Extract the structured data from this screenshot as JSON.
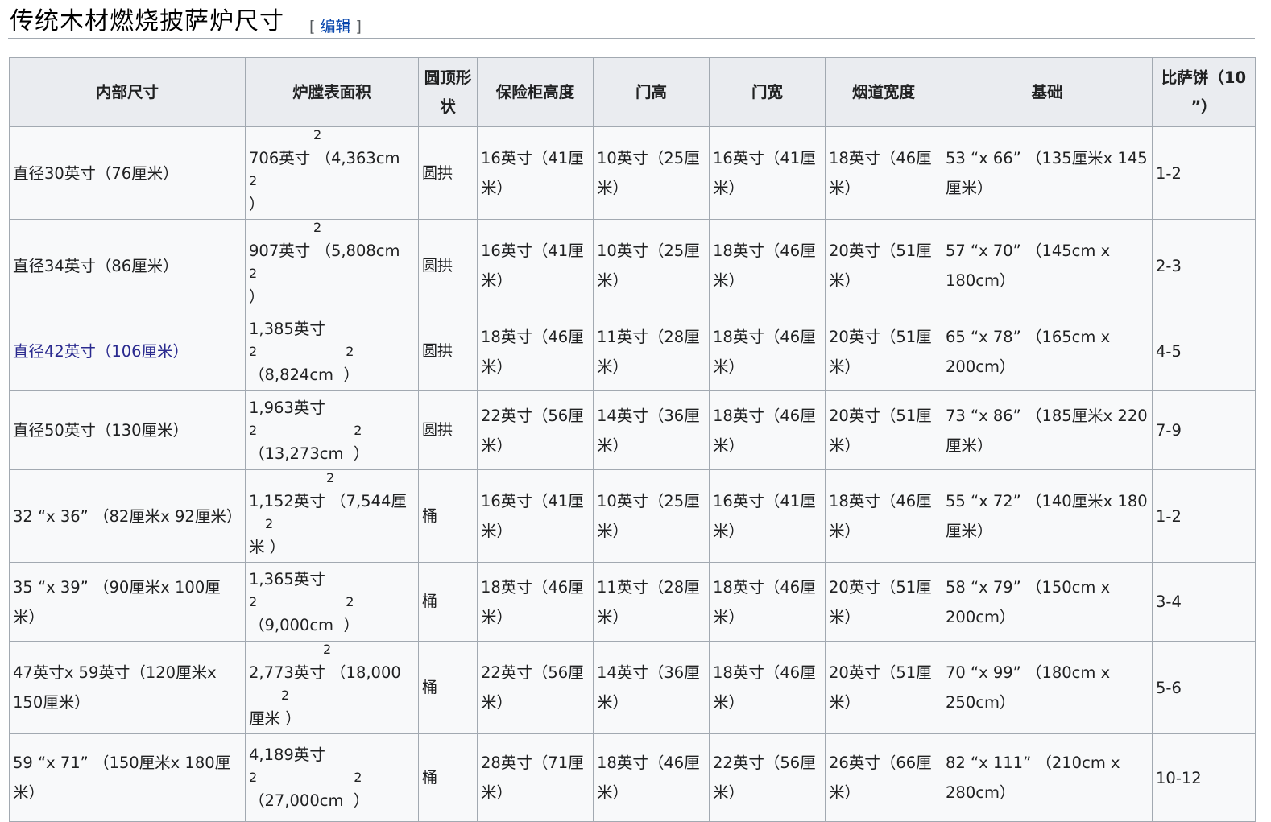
{
  "heading": {
    "title": "传统木材燃烧披萨炉尺寸",
    "edit_open": "[",
    "edit_label": "编辑",
    "edit_close": "]"
  },
  "table": {
    "headers": [
      "内部尺寸",
      "炉膛表面积",
      "圆顶形状",
      "保险柜高度",
      "门高",
      "门宽",
      "烟道宽度",
      "基础",
      "比萨饼（10 ”）"
    ],
    "rows": [
      {
        "inside": "直径30英寸（76厘米）",
        "area_main": "706英寸",
        "area_sup": "2",
        "area_metric": "（4,363cm",
        "area_sub": "2",
        "area_close": "）",
        "shape": "圆拱",
        "vault": "16英寸（41厘米）",
        "door_h": "10英寸（25厘米）",
        "door_w": "16英寸（41厘米）",
        "flue": "18英寸（46厘米）",
        "base": "53 “x 66” （135厘米x 145厘米）",
        "pizzas": "1-2"
      },
      {
        "inside": "直径34英寸（86厘米）",
        "area_main": "907英寸",
        "area_sup": "2",
        "area_metric": "（5,808cm",
        "area_sub": "2",
        "area_close": "）",
        "shape": "圆拱",
        "vault": "16英寸（41厘米）",
        "door_h": "10英寸（25厘米）",
        "door_w": "18英寸（46厘米）",
        "flue": "20英寸（51厘米）",
        "base": "57 “x 70” （145cm x 180cm）",
        "pizzas": "2-3"
      },
      {
        "inside": "直径42英寸（106厘米）",
        "area_main": "1,385英寸",
        "area_sup": "2",
        "area_metric": "（8,824cm",
        "area_sub": "2",
        "area_close": "）",
        "shape": "圆拱",
        "vault": "18英寸（46厘米）",
        "door_h": "11英寸（28厘米）",
        "door_w": "18英寸（46厘米）",
        "flue": "20英寸（51厘米）",
        "base": "65 “x 78” （165cm x 200cm）",
        "pizzas": "4-5"
      },
      {
        "inside": "直径50英寸（130厘米）",
        "area_main": "1,963英寸",
        "area_sup": "2",
        "area_metric": "（13,273cm",
        "area_sub": "2",
        "area_close": "）",
        "shape": "圆拱",
        "vault": "22英寸（56厘米）",
        "door_h": "14英寸（36厘米）",
        "door_w": "18英寸（46厘米）",
        "flue": "20英寸（51厘米）",
        "base": "73 “x 86” （185厘米x 220厘米）",
        "pizzas": "7-9"
      },
      {
        "inside": "32 “x 36” （82厘米x 92厘米）",
        "area_main": "1,152英寸",
        "area_sup": "2",
        "area_metric": "（7,544厘",
        "area_sub": "2",
        "area_close": "米 ）",
        "shape": "桶",
        "vault": "16英寸（41厘米）",
        "door_h": "10英寸（25厘米）",
        "door_w": "16英寸（41厘米）",
        "flue": "18英寸（46厘米）",
        "base": "55 “x 72” （140厘米x 180厘米）",
        "pizzas": "1-2"
      },
      {
        "inside": "35 “x 39” （90厘米x 100厘米）",
        "area_main": "1,365英寸",
        "area_sup": "2",
        "area_metric": "（9,000cm",
        "area_sub": "2",
        "area_close": "）",
        "shape": "桶",
        "vault": "18英寸（46厘米）",
        "door_h": "11英寸（28厘米）",
        "door_w": "18英寸（46厘米）",
        "flue": "20英寸（51厘米）",
        "base": "58 “x 79” （150cm x 200cm）",
        "pizzas": "3-4"
      },
      {
        "inside": "47英寸x 59英寸（120厘米x 150厘米）",
        "area_main": "2,773英寸",
        "area_sup": "2",
        "area_metric": "（18,000",
        "area_sub": "2",
        "area_close": "厘米 ）",
        "shape": "桶",
        "vault": "22英寸（56厘米）",
        "door_h": "14英寸（36厘米）",
        "door_w": "18英寸（46厘米）",
        "flue": "20英寸（51厘米）",
        "base": "70 “x 99” （180cm x 250cm）",
        "pizzas": "5-6"
      },
      {
        "inside": "59 “x 71” （150厘米x 180厘米）",
        "area_main": "4,189英寸",
        "area_sup": "2",
        "area_metric": "（27,000cm",
        "area_sub": "2",
        "area_close": "）",
        "shape": "桶",
        "vault": "28英寸（71厘米）",
        "door_h": "18英寸（46厘米）",
        "door_w": "22英寸（56厘米）",
        "flue": "26英寸（66厘米）",
        "base": "82 “x 111” （210cm x 280cm）",
        "pizzas": "10-12"
      }
    ]
  }
}
